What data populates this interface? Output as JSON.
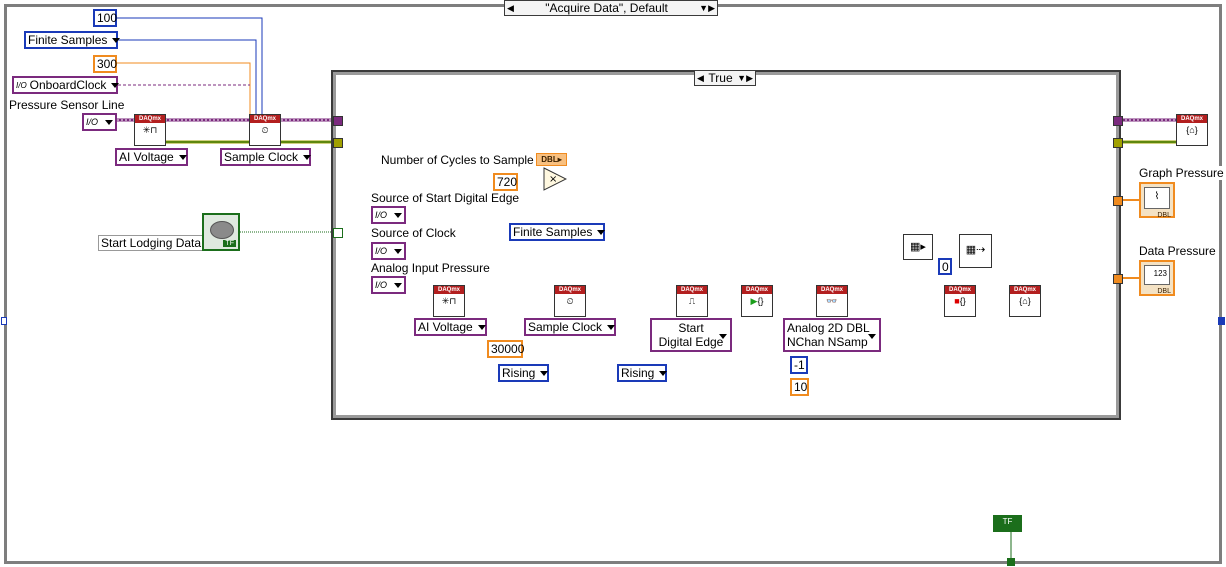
{
  "case_structure": {
    "selector_label": "\"Acquire Data\", Default",
    "inner_selector_label": "True"
  },
  "outer": {
    "samples_const": "100",
    "sample_mode": "Finite Samples",
    "rate_const": "300",
    "clock_source": "OnboardClock",
    "pressure_line_label": "Pressure Sensor Line",
    "create_channel": "AI Voltage",
    "timing": "Sample Clock",
    "start_button_label": "Start Lodging Data",
    "bool_tf": "TF"
  },
  "inner": {
    "num_cycles_label": "Number of Cycles to Sample",
    "dbl_badge": "DBL",
    "multiplier_const": "720",
    "start_edge_label": "Source of Start Digital Edge",
    "source_clock_label": "Source of Clock",
    "analog_input_label": "Analog Input Pressure",
    "sample_mode": "Finite Samples",
    "create_channel": "AI Voltage",
    "timing": "Sample Clock",
    "rate_const": "30000",
    "edge_rising_1": "Rising",
    "trigger_line1": "Start",
    "trigger_line2": "Digital Edge",
    "edge_rising_2": "Rising",
    "read_line1": "Analog 2D DBL",
    "read_line2": "NChan NSamp",
    "channels_const": "-1",
    "samples_const": "10",
    "index_const": "0"
  },
  "outputs": {
    "graph_label": "Graph Pressure",
    "data_label": "Data Pressure",
    "array_badge": "123",
    "dbl_badge": "DBL"
  },
  "daqmx_badge": "DAQmx",
  "colors": {
    "purple_wire": "#7b2a7e",
    "blue_wire": "#1a3ab8",
    "orange_wire": "#f08b1f",
    "green_wire": "#1b6e1b",
    "error_wire": "#a0a000"
  },
  "icons": [
    "create-channel-icon",
    "timing-icon",
    "trigger-icon",
    "start-task-icon",
    "read-icon",
    "stop-task-icon",
    "clear-task-icon",
    "multiply-icon",
    "index-array-icon",
    "graph-indicator-icon",
    "array-indicator-icon"
  ]
}
